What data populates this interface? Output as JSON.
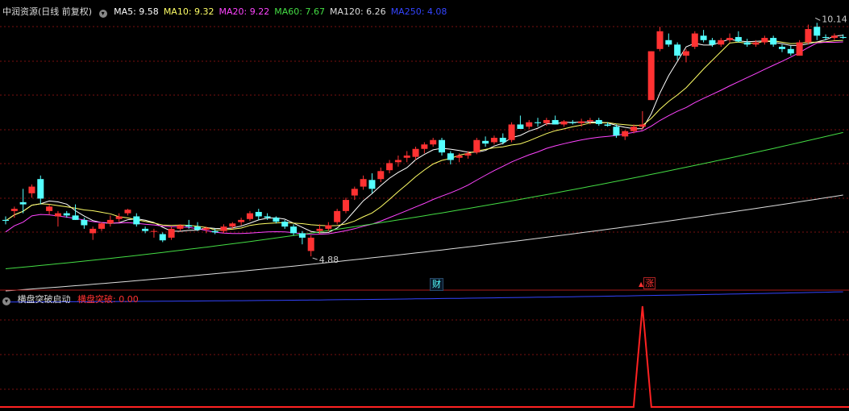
{
  "title": {
    "stock": "中润资源",
    "mode": "(日线 前复权)",
    "ma_legend": [
      {
        "label": "MA5:",
        "value": "9.58",
        "color": "#ffffff"
      },
      {
        "label": "MA10:",
        "value": "9.32",
        "color": "#ffff66"
      },
      {
        "label": "MA20:",
        "value": "9.22",
        "color": "#ff44ff"
      },
      {
        "label": "MA60:",
        "value": "7.67",
        "color": "#44dd44"
      },
      {
        "label": "MA120:",
        "value": "6.26",
        "color": "#dddddd"
      },
      {
        "label": "MA250:",
        "value": "4.08",
        "color": "#3344ff"
      }
    ]
  },
  "indicator": {
    "name": "横盘突破启动",
    "value_label": "横盘突破:",
    "value": "0.00"
  },
  "badges": {
    "cai": "财",
    "zhang": "涨"
  },
  "chart_data": {
    "type": "candlestick",
    "price_range": [
      4.3,
      10.4
    ],
    "high_label": "10.14",
    "low_label": "4.88",
    "colors": {
      "up": "#ff3232",
      "down": "#54ffff",
      "grid": "#7a1010"
    },
    "candles": [
      [
        5.7,
        5.78,
        5.6,
        5.68
      ],
      [
        5.9,
        6.0,
        5.75,
        5.95
      ],
      [
        6.1,
        6.4,
        5.85,
        6.05
      ],
      [
        6.3,
        6.5,
        6.2,
        6.45
      ],
      [
        6.62,
        6.7,
        6.05,
        6.18
      ],
      [
        5.9,
        6.05,
        5.82,
        6.0
      ],
      [
        5.78,
        5.9,
        5.55,
        5.85
      ],
      [
        5.85,
        5.9,
        5.75,
        5.8
      ],
      [
        5.8,
        6.05,
        5.7,
        5.7
      ],
      [
        5.7,
        5.75,
        5.5,
        5.58
      ],
      [
        5.4,
        5.55,
        5.25,
        5.5
      ],
      [
        5.5,
        5.65,
        5.45,
        5.62
      ],
      [
        5.62,
        5.8,
        5.55,
        5.7
      ],
      [
        5.72,
        5.85,
        5.65,
        5.78
      ],
      [
        5.85,
        5.95,
        5.8,
        5.93
      ],
      [
        5.78,
        5.85,
        5.55,
        5.6
      ],
      [
        5.5,
        5.55,
        5.4,
        5.45
      ],
      [
        5.45,
        5.5,
        5.3,
        5.45
      ],
      [
        5.38,
        5.42,
        5.2,
        5.24
      ],
      [
        5.3,
        5.55,
        5.25,
        5.5
      ],
      [
        5.5,
        5.6,
        5.45,
        5.58
      ],
      [
        5.58,
        5.7,
        5.5,
        5.55
      ],
      [
        5.55,
        5.65,
        5.45,
        5.48
      ],
      [
        5.48,
        5.55,
        5.4,
        5.52
      ],
      [
        5.45,
        5.5,
        5.38,
        5.42
      ],
      [
        5.45,
        5.6,
        5.4,
        5.55
      ],
      [
        5.55,
        5.65,
        5.5,
        5.62
      ],
      [
        5.65,
        5.75,
        5.58,
        5.7
      ],
      [
        5.72,
        5.9,
        5.68,
        5.85
      ],
      [
        5.88,
        5.95,
        5.7,
        5.78
      ],
      [
        5.78,
        5.85,
        5.7,
        5.75
      ],
      [
        5.75,
        5.78,
        5.62,
        5.66
      ],
      [
        5.66,
        5.7,
        5.5,
        5.55
      ],
      [
        5.55,
        5.6,
        5.35,
        5.4
      ],
      [
        5.4,
        5.45,
        5.15,
        5.3
      ],
      [
        5.0,
        5.35,
        4.88,
        5.3
      ],
      [
        5.45,
        5.6,
        5.38,
        5.5
      ],
      [
        5.5,
        5.65,
        5.45,
        5.58
      ],
      [
        5.65,
        5.95,
        5.6,
        5.9
      ],
      [
        5.9,
        6.2,
        5.85,
        6.15
      ],
      [
        6.25,
        6.45,
        6.15,
        6.4
      ],
      [
        6.45,
        6.7,
        6.38,
        6.62
      ],
      [
        6.6,
        6.75,
        6.3,
        6.4
      ],
      [
        6.62,
        6.88,
        6.55,
        6.8
      ],
      [
        6.82,
        7.05,
        6.75,
        6.98
      ],
      [
        7.0,
        7.15,
        6.9,
        7.05
      ],
      [
        7.1,
        7.25,
        7.0,
        7.15
      ],
      [
        7.12,
        7.35,
        7.05,
        7.3
      ],
      [
        7.3,
        7.45,
        7.2,
        7.4
      ],
      [
        7.4,
        7.55,
        7.35,
        7.5
      ],
      [
        7.5,
        7.55,
        7.15,
        7.22
      ],
      [
        7.2,
        7.25,
        6.95,
        7.05
      ],
      [
        7.1,
        7.2,
        7.0,
        7.15
      ],
      [
        7.15,
        7.25,
        7.08,
        7.2
      ],
      [
        7.22,
        7.55,
        7.18,
        7.5
      ],
      [
        7.48,
        7.58,
        7.35,
        7.42
      ],
      [
        7.45,
        7.6,
        7.4,
        7.55
      ],
      [
        7.55,
        7.65,
        7.4,
        7.45
      ],
      [
        7.5,
        7.9,
        7.45,
        7.85
      ],
      [
        7.85,
        8.05,
        7.75,
        7.75
      ],
      [
        7.8,
        7.95,
        7.75,
        7.9
      ],
      [
        7.9,
        8.0,
        7.8,
        7.88
      ],
      [
        7.88,
        8.0,
        7.82,
        7.95
      ],
      [
        7.95,
        8.05,
        7.85,
        7.85
      ],
      [
        7.85,
        7.95,
        7.8,
        7.92
      ],
      [
        7.9,
        7.95,
        7.85,
        7.88
      ],
      [
        7.88,
        7.98,
        7.8,
        7.92
      ],
      [
        7.92,
        8.0,
        7.85,
        7.95
      ],
      [
        7.95,
        8.0,
        7.82,
        7.86
      ],
      [
        7.85,
        7.9,
        7.8,
        7.82
      ],
      [
        7.8,
        7.85,
        7.55,
        7.6
      ],
      [
        7.58,
        7.72,
        7.5,
        7.7
      ],
      [
        7.7,
        7.85,
        7.65,
        7.8
      ],
      [
        7.8,
        8.15,
        7.75,
        7.85
      ],
      [
        8.4,
        9.5,
        8.4,
        9.5
      ],
      [
        9.55,
        10.05,
        9.5,
        9.95
      ],
      [
        9.75,
        9.9,
        9.6,
        9.65
      ],
      [
        9.65,
        9.7,
        9.3,
        9.4
      ],
      [
        9.4,
        9.55,
        9.25,
        9.5
      ],
      [
        9.6,
        9.95,
        9.55,
        9.9
      ],
      [
        9.85,
        9.98,
        9.7,
        9.75
      ],
      [
        9.75,
        9.8,
        9.6,
        9.65
      ],
      [
        9.65,
        9.8,
        9.6,
        9.75
      ],
      [
        9.75,
        9.9,
        9.7,
        9.8
      ],
      [
        9.82,
        9.95,
        9.7,
        9.72
      ],
      [
        9.7,
        9.78,
        9.6,
        9.65
      ],
      [
        9.65,
        9.75,
        9.6,
        9.7
      ],
      [
        9.7,
        9.85,
        9.65,
        9.8
      ],
      [
        9.8,
        9.85,
        9.6,
        9.65
      ],
      [
        9.6,
        9.65,
        9.48,
        9.55
      ],
      [
        9.55,
        9.62,
        9.4,
        9.45
      ],
      [
        9.4,
        9.75,
        9.4,
        9.7
      ],
      [
        9.7,
        10.1,
        9.65,
        10.0
      ],
      [
        10.05,
        10.14,
        9.75,
        9.85
      ],
      [
        9.82,
        9.88,
        9.75,
        9.8
      ],
      [
        9.8,
        9.9,
        9.75,
        9.85
      ],
      [
        9.82,
        9.88,
        9.78,
        9.8
      ]
    ],
    "signal": {
      "index": 73,
      "value": 1
    }
  }
}
